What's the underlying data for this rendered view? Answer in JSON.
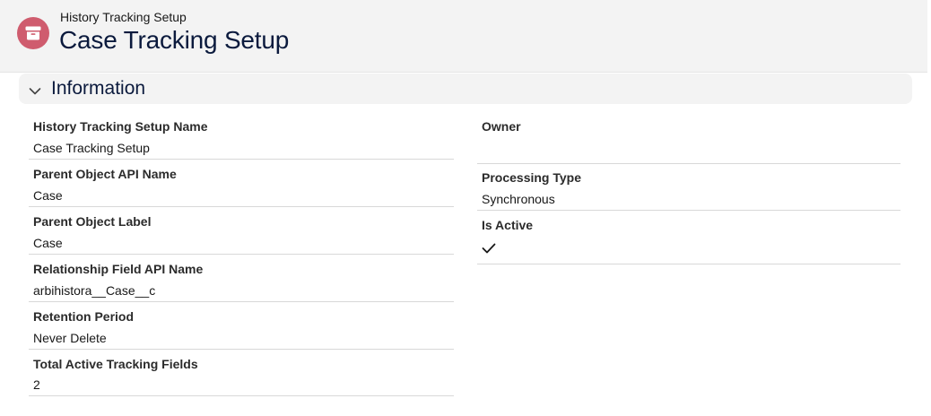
{
  "header": {
    "object_type": "History Tracking Setup",
    "record_title": "Case Tracking Setup",
    "icon": "archive-box-icon",
    "icon_color": "#cf5c6e"
  },
  "section": {
    "title": "Information",
    "expanded": true
  },
  "fields_left": [
    {
      "label": "History Tracking Setup Name",
      "value": "Case Tracking Setup"
    },
    {
      "label": "Parent Object API Name",
      "value": "Case"
    },
    {
      "label": "Parent Object Label",
      "value": "Case"
    },
    {
      "label": "Relationship Field API Name",
      "value": "arbihistora__Case__c"
    },
    {
      "label": "Retention Period",
      "value": "Never Delete"
    },
    {
      "label": "Total Active Tracking Fields",
      "value": "2"
    }
  ],
  "fields_right": [
    {
      "label": "Owner",
      "value": ""
    },
    {
      "label": "Processing Type",
      "value": "Synchronous"
    },
    {
      "label": "Is Active",
      "value": "",
      "checked": true
    }
  ],
  "colors": {
    "header_bg": "#f3f3f3",
    "title": "#0b1a3d",
    "divider": "#d8d8d8"
  }
}
